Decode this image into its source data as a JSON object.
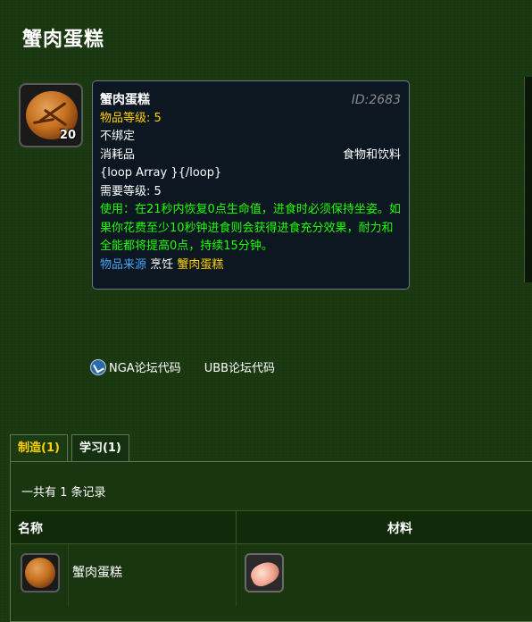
{
  "page": {
    "title": "蟹肉蛋糕"
  },
  "item": {
    "stack_count": "20",
    "tooltip": {
      "name": "蟹肉蛋糕",
      "id": "ID:2683",
      "item_level": "物品等级: 5",
      "binding": "不绑定",
      "type": "消耗品",
      "category": "食物和饮料",
      "loop_text": "{loop Array }{/loop}",
      "required_level": "需要等级: 5",
      "use_effect": "使用：在21秒内恢复0点生命值，进食时必须保持坐姿。如果你花费至少10秒钟进食则会获得进食充分效果，耐力和全能都将提高0点，持续15分钟。",
      "source_label": "物品来源",
      "source_type": "烹饪",
      "source_name": "蟹肉蛋糕"
    }
  },
  "links": {
    "nga": "NGA论坛代码",
    "ubb": "UBB论坛代码"
  },
  "tabs": [
    {
      "label": "制造(1)",
      "active": true
    },
    {
      "label": "学习(1)",
      "active": false
    }
  ],
  "records": "一共有 1 条记录",
  "table": {
    "headers": {
      "name": "名称",
      "materials": "材料"
    },
    "rows": [
      {
        "name": "蟹肉蛋糕"
      }
    ]
  },
  "colors": {
    "quality_yellow": "#ffd100",
    "use_green": "#1eff00",
    "source_blue": "#42a5f5"
  }
}
